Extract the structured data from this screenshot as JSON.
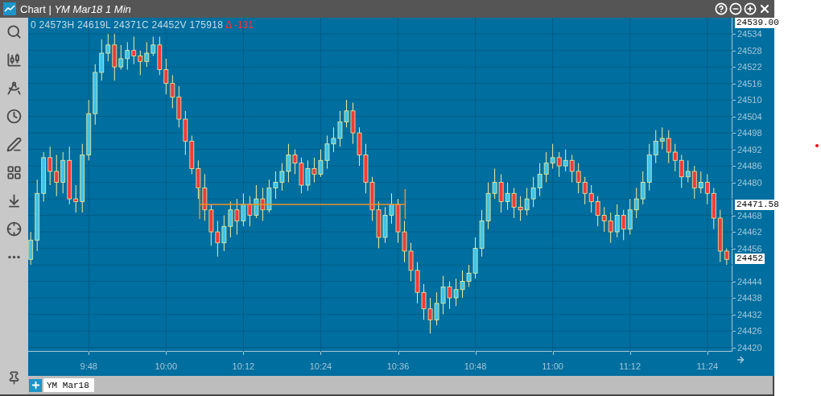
{
  "window": {
    "title": "Chart | *YM Mar18 1 Min*"
  },
  "quote": {
    "ohlc": "0 24573H 24619L 24371C 24452V 175918",
    "change": "Δ -131"
  },
  "chart_data": {
    "type": "candlestick",
    "grid": true,
    "ylim": [
      24418.4,
      24539.9
    ],
    "xlim": [
      578.6,
      687.9
    ],
    "x": [
      579,
      580,
      581,
      582,
      583,
      584,
      585,
      586,
      587,
      588,
      589,
      590,
      591,
      592,
      593,
      594,
      595,
      596,
      597,
      598,
      599,
      600,
      601,
      602,
      603,
      604,
      605,
      606,
      607,
      608,
      609,
      610,
      611,
      612,
      613,
      614,
      615,
      616,
      617,
      618,
      619,
      620,
      621,
      622,
      623,
      624,
      625,
      626,
      627,
      628,
      629,
      630,
      631,
      632,
      633,
      634,
      635,
      636,
      637,
      638,
      639,
      640,
      641,
      642,
      643,
      644,
      645,
      646,
      647,
      648,
      649,
      650,
      651,
      652,
      653,
      654,
      655,
      656,
      657,
      658,
      659,
      660,
      661,
      662,
      663,
      664,
      665,
      666,
      667,
      668,
      669,
      670,
      671,
      672,
      673,
      674,
      675,
      676,
      677,
      678,
      679,
      680,
      681,
      682,
      683,
      684,
      685,
      686,
      687
    ],
    "xticks": [
      {
        "value": 588,
        "label": "9:48"
      },
      {
        "value": 600,
        "label": "10:00"
      },
      {
        "value": 612,
        "label": "10:12"
      },
      {
        "value": 624,
        "label": "10:24"
      },
      {
        "value": 636,
        "label": "10:36"
      },
      {
        "value": 648,
        "label": "10:48"
      },
      {
        "value": 660,
        "label": "11:00"
      },
      {
        "value": 672,
        "label": "11:12"
      },
      {
        "value": 684,
        "label": "11:24"
      }
    ],
    "yticks": [
      24534,
      24528,
      24522,
      24516,
      24510,
      24504,
      24498,
      24492,
      24486,
      24480,
      24468,
      24462,
      24456,
      24444,
      24438,
      24432,
      24426,
      24420
    ],
    "annotations": [
      "24539.00",
      "24471.58",
      "24452"
    ],
    "ref_lines": [
      {
        "axis": "y",
        "value": 24472,
        "color": "#f0902a"
      },
      {
        "axis": "x",
        "value": 605.2,
        "color": "#f0902a"
      },
      {
        "axis": "x",
        "value": 637.1,
        "color": "#f0902a"
      }
    ],
    "ohlc": [
      [
        24452,
        24462,
        24450,
        24459
      ],
      [
        24459,
        24481,
        24455,
        24476
      ],
      [
        24476,
        24491,
        24473,
        24489
      ],
      [
        24489,
        24493,
        24479,
        24484
      ],
      [
        24484,
        24490,
        24475,
        24480
      ],
      [
        24480,
        24491,
        24476,
        24488
      ],
      [
        24488,
        24493,
        24472,
        24474
      ],
      [
        24474,
        24479,
        24469,
        24473
      ],
      [
        24473,
        24494,
        24469,
        24490
      ],
      [
        24490,
        24510,
        24488,
        24505
      ],
      [
        24505,
        24523,
        24501,
        24520
      ],
      [
        24520,
        24532,
        24517,
        24527
      ],
      [
        24527,
        24534,
        24524,
        24530
      ],
      [
        24530,
        24534,
        24517,
        24522
      ],
      [
        24522,
        24530,
        24521,
        24525
      ],
      [
        24525,
        24531,
        24521,
        24528
      ],
      [
        24528,
        24533,
        24523,
        24526
      ],
      [
        24526,
        24528,
        24519,
        24524
      ],
      [
        24524,
        24531,
        24522,
        24527
      ],
      [
        24527,
        24533,
        24526,
        24530
      ],
      [
        24530,
        24533,
        24519,
        24521
      ],
      [
        24521,
        24525,
        24512,
        24516
      ],
      [
        24516,
        24519,
        24507,
        24511
      ],
      [
        24511,
        24515,
        24500,
        24503
      ],
      [
        24503,
        24506,
        24490,
        24495
      ],
      [
        24495,
        24497,
        24483,
        24485
      ],
      [
        24485,
        24488,
        24474,
        24478
      ],
      [
        24478,
        24483,
        24466,
        24470
      ],
      [
        24470,
        24472,
        24457,
        24462
      ],
      [
        24462,
        24466,
        24453,
        24458
      ],
      [
        24458,
        24468,
        24455,
        24464
      ],
      [
        24464,
        24473,
        24460,
        24470
      ],
      [
        24470,
        24474,
        24461,
        24466
      ],
      [
        24466,
        24476,
        24464,
        24472
      ],
      [
        24472,
        24475,
        24464,
        24468
      ],
      [
        24468,
        24479,
        24467,
        24474
      ],
      [
        24474,
        24478,
        24466,
        24470
      ],
      [
        24470,
        24481,
        24469,
        24478
      ],
      [
        24478,
        24484,
        24474,
        24480
      ],
      [
        24480,
        24487,
        24477,
        24484
      ],
      [
        24484,
        24494,
        24480,
        24490
      ],
      [
        24490,
        24492,
        24483,
        24487
      ],
      [
        24487,
        24489,
        24476,
        24479
      ],
      [
        24479,
        24488,
        24477,
        24485
      ],
      [
        24485,
        24489,
        24480,
        24483
      ],
      [
        24483,
        24492,
        24482,
        24488
      ],
      [
        24488,
        24497,
        24485,
        24494
      ],
      [
        24494,
        24500,
        24491,
        24496
      ],
      [
        24496,
        24506,
        24493,
        24502
      ],
      [
        24502,
        24510,
        24500,
        24506
      ],
      [
        24506,
        24509,
        24494,
        24498
      ],
      [
        24498,
        24500,
        24486,
        24490
      ],
      [
        24490,
        24494,
        24476,
        24480
      ],
      [
        24480,
        24482,
        24466,
        24470
      ],
      [
        24470,
        24473,
        24456,
        24460
      ],
      [
        24460,
        24471,
        24458,
        24468
      ],
      [
        24468,
        24476,
        24465,
        24472
      ],
      [
        24472,
        24474,
        24458,
        24462
      ],
      [
        24462,
        24466,
        24451,
        24455
      ],
      [
        24455,
        24458,
        24444,
        24448
      ],
      [
        24448,
        24451,
        24436,
        24440
      ],
      [
        24440,
        24443,
        24430,
        24434
      ],
      [
        24434,
        24438,
        24425,
        24430
      ],
      [
        24430,
        24440,
        24428,
        24436
      ],
      [
        24436,
        24446,
        24432,
        24442
      ],
      [
        24442,
        24444,
        24434,
        24438
      ],
      [
        24438,
        24445,
        24435,
        24441
      ],
      [
        24441,
        24448,
        24438,
        24444
      ],
      [
        24444,
        24450,
        24442,
        24447
      ],
      [
        24447,
        24460,
        24445,
        24456
      ],
      [
        24456,
        24470,
        24453,
        24466
      ],
      [
        24466,
        24480,
        24463,
        24476
      ],
      [
        24476,
        24485,
        24474,
        24480
      ],
      [
        24480,
        24483,
        24469,
        24473
      ],
      [
        24473,
        24480,
        24470,
        24476
      ],
      [
        24476,
        24478,
        24467,
        24471
      ],
      [
        24471,
        24475,
        24466,
        24470
      ],
      [
        24470,
        24478,
        24468,
        24474
      ],
      [
        24474,
        24482,
        24471,
        24478
      ],
      [
        24478,
        24487,
        24475,
        24483
      ],
      [
        24483,
        24491,
        24480,
        24487
      ],
      [
        24487,
        24494,
        24485,
        24489
      ],
      [
        24489,
        24491,
        24482,
        24486
      ],
      [
        24486,
        24492,
        24484,
        24488
      ],
      [
        24488,
        24490,
        24480,
        24484
      ],
      [
        24484,
        24487,
        24476,
        24480
      ],
      [
        24480,
        24482,
        24472,
        24476
      ],
      [
        24476,
        24479,
        24469,
        24473
      ],
      [
        24473,
        24475,
        24464,
        24468
      ],
      [
        24468,
        24471,
        24462,
        24466
      ],
      [
        24466,
        24469,
        24458,
        24462
      ],
      [
        24462,
        24472,
        24460,
        24468
      ],
      [
        24468,
        24470,
        24459,
        24463
      ],
      [
        24463,
        24474,
        24461,
        24470
      ],
      [
        24470,
        24478,
        24467,
        24474
      ],
      [
        24474,
        24484,
        24472,
        24480
      ],
      [
        24480,
        24494,
        24477,
        24490
      ],
      [
        24490,
        24499,
        24487,
        24495
      ],
      [
        24495,
        24500,
        24492,
        24496
      ],
      [
        24496,
        24499,
        24487,
        24491
      ],
      [
        24491,
        24494,
        24484,
        24488
      ],
      [
        24488,
        24490,
        24478,
        24482
      ],
      [
        24482,
        24488,
        24480,
        24484
      ],
      [
        24484,
        24486,
        24474,
        24478
      ],
      [
        24478,
        24484,
        24476,
        24480
      ],
      [
        24480,
        24483,
        24472,
        24476
      ],
      [
        24476,
        24478,
        24463,
        24467
      ],
      [
        24467,
        24470,
        24451,
        24455
      ],
      [
        24455,
        24456,
        24450,
        24452
      ]
    ]
  },
  "tabs": [
    {
      "label": "YM Mar18",
      "selected": true
    }
  ]
}
